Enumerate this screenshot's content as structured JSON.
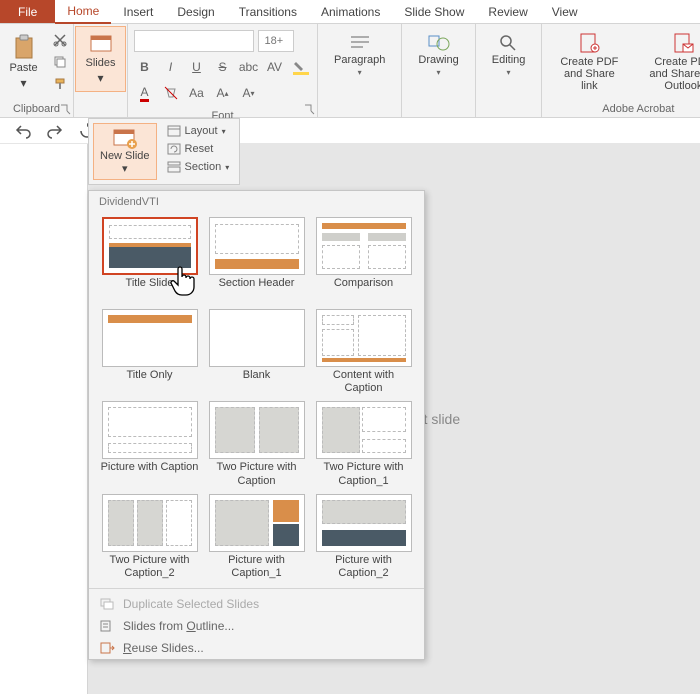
{
  "tabs": {
    "file": "File",
    "home": "Home",
    "insert": "Insert",
    "design": "Design",
    "transitions": "Transitions",
    "animations": "Animations",
    "slideshow": "Slide Show",
    "review": "Review",
    "view": "View"
  },
  "ribbon": {
    "clipboard_label": "Clipboard",
    "paste": "Paste",
    "slides_label": "Slides",
    "font_label": "Font",
    "fontsize_value": "18+",
    "paragraph": "Paragraph",
    "drawing": "Drawing",
    "editing": "Editing",
    "create_pdf_share": "Create PDF and Share link",
    "create_pdf_outlook": "Create PDF and Share via Outlook",
    "acrobat_label": "Adobe Acrobat"
  },
  "newslide_panel": {
    "newslide": "New Slide",
    "layout": "Layout",
    "reset": "Reset",
    "section": "Section"
  },
  "gallery": {
    "theme": "DividendVTI",
    "items": [
      "Title Slide",
      "Section Header",
      "Comparison",
      "Title Only",
      "Blank",
      "Content with Caption",
      "Picture with Caption",
      "Two Picture with Caption",
      "Two Picture with Caption_1",
      "Two Picture with Caption_2",
      "Picture with Caption_1",
      "Picture with Caption_2"
    ],
    "duplicate": "Duplicate Selected Slides",
    "outline": "Slides from Outline...",
    "reuse": "Reuse Slides..."
  },
  "canvas": {
    "placeholder": "Click to add first slide"
  }
}
